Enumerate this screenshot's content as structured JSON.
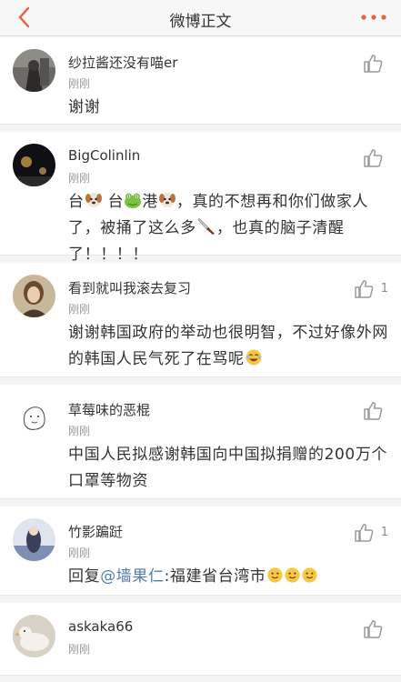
{
  "nav": {
    "title": "微博正文",
    "back_icon": "chevron-left-icon",
    "more_icon": "ellipsis-icon",
    "accent": "#e8603c"
  },
  "comments": [
    {
      "user": "纱拉酱还没有喵er",
      "time": "刚刚",
      "text": "谢谢",
      "likes": ""
    },
    {
      "user": "BigColinlin",
      "time": "刚刚",
      "text_parts": [
        "台",
        "台",
        "港",
        "，真的不想再和你们做家人了，被捅了这么多",
        "，也真的脑子清醒了！！！！"
      ],
      "likes": ""
    },
    {
      "user": "看到就叫我滚去复习",
      "time": "刚刚",
      "text": "谢谢韩国政府的举动也很明智，不过好像外网的韩国人民气死了在骂呢",
      "likes": "1"
    },
    {
      "user": "草莓味的恶棍",
      "time": "刚刚",
      "text": "中国人民拟感谢韩国向中国拟捐赠的200万个口罩等物资",
      "likes": ""
    },
    {
      "user": "竹影蹁跹",
      "time": "刚刚",
      "reply_prefix": "回复",
      "mention": "@墙果仁",
      "reply_text": ":福建省台湾市",
      "likes": "1"
    },
    {
      "user": "askaka66",
      "time": "刚刚",
      "text": "",
      "likes": ""
    }
  ],
  "colors": {
    "mention": "#507daf",
    "icon_gray": "#9a9a9a"
  }
}
